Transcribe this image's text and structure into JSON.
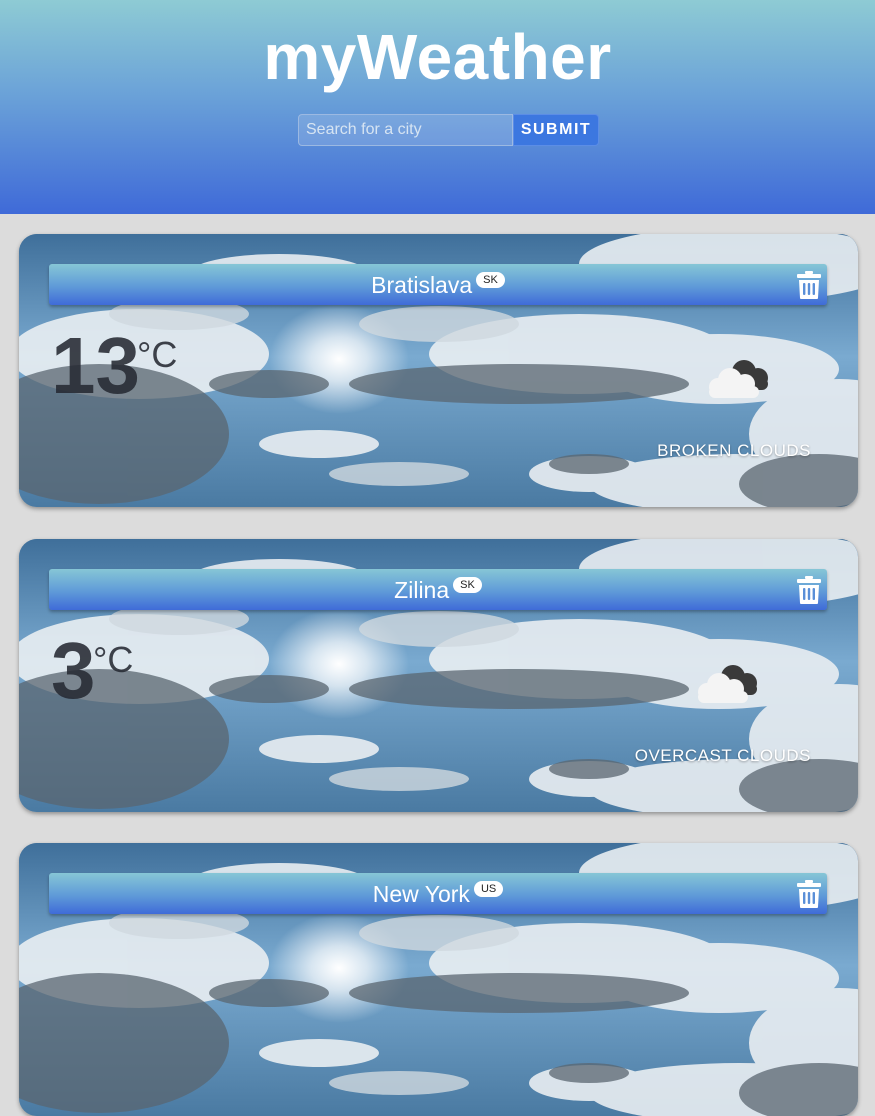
{
  "header": {
    "title": "myWeather",
    "search_placeholder": "Search for a city",
    "search_value": "",
    "submit_label": "SUBMIT"
  },
  "cards": [
    {
      "city": "Bratislava",
      "country": "SK",
      "temp": "13",
      "unit": "°C",
      "condition": "BROKEN CLOUDS",
      "icon": "cloud-icon"
    },
    {
      "city": "Zilina",
      "country": "SK",
      "temp": "3",
      "unit": "°C",
      "condition": "OVERCAST CLOUDS",
      "icon": "cloud-icon"
    },
    {
      "city": "New York",
      "country": "US"
    }
  ],
  "colors": {
    "header_top": "#8ecbd4",
    "header_bottom": "#3f6ad8",
    "submit_bg": "#3c77e0",
    "page_bg": "#dcdcdc"
  }
}
